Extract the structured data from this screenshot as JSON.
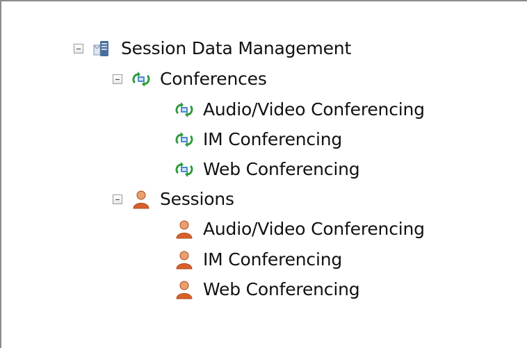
{
  "tree": {
    "root": {
      "label": "Session Data Management",
      "icon": "server-icon",
      "expanded": true
    },
    "conferences": {
      "label": "Conferences",
      "icon": "conference-icon",
      "expanded": true,
      "children": [
        {
          "label": "Audio/Video Conferencing",
          "icon": "conference-icon"
        },
        {
          "label": "IM Conferencing",
          "icon": "conference-icon"
        },
        {
          "label": "Web Conferencing",
          "icon": "conference-icon"
        }
      ]
    },
    "sessions": {
      "label": "Sessions",
      "icon": "user-icon",
      "expanded": true,
      "children": [
        {
          "label": "Audio/Video Conferencing",
          "icon": "user-icon"
        },
        {
          "label": "IM Conferencing",
          "icon": "user-icon"
        },
        {
          "label": "Web Conferencing",
          "icon": "user-icon"
        }
      ]
    }
  },
  "colors": {
    "frame_border": "#8c8c8c",
    "conference_green": "#2e9b3a",
    "user_orange": "#d8602a"
  }
}
